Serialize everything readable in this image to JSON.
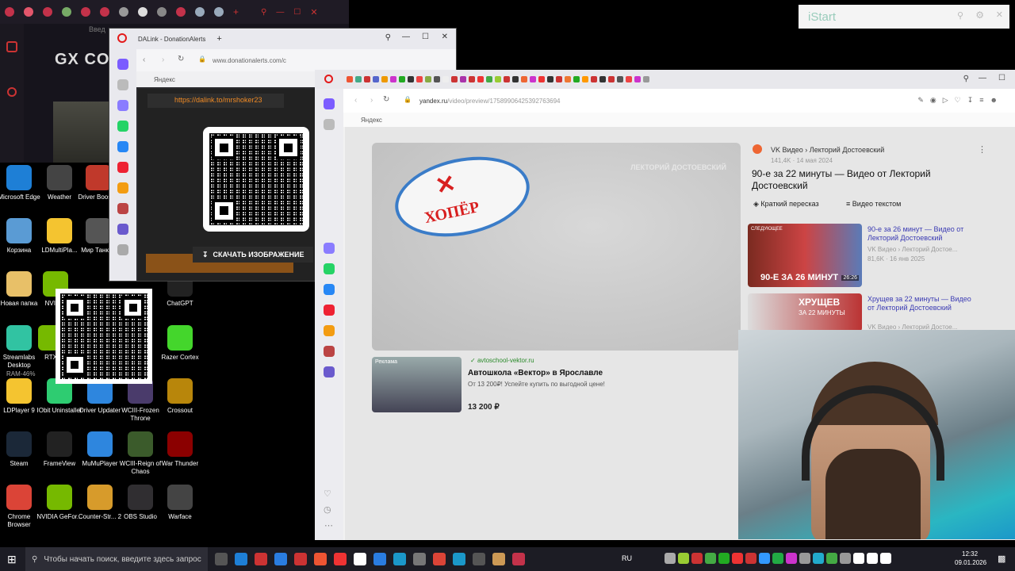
{
  "desktop": {
    "icons": [
      {
        "label": "Microsoft Edge",
        "color": "#1e7fd6"
      },
      {
        "label": "Weather",
        "color": "#444"
      },
      {
        "label": "Driver Booster",
        "color": "#c0392b"
      },
      {
        "label": "Корзина",
        "color": "#5a9bd4"
      },
      {
        "label": "LDMultiPla...",
        "color": "#f4c430"
      },
      {
        "label": "Мир Танков",
        "color": "#555"
      },
      {
        "label": "Новая папка",
        "color": "#e8c068"
      },
      {
        "label": "NVIDIA",
        "color": "#76b900"
      },
      {
        "label": "ChatGPT",
        "color": "#222"
      },
      {
        "label": "Streamlabs Desktop",
        "color": "#31c3a2"
      },
      {
        "label": "RTX",
        "color": "#76b900"
      },
      {
        "label": "Razer Cortex",
        "color": "#44d62c"
      },
      {
        "label": "LDPlayer 9",
        "color": "#f4c430"
      },
      {
        "label": "IObit Uninstaller",
        "color": "#2ecc71"
      },
      {
        "label": "Driver Updater",
        "color": "#2e86de"
      },
      {
        "label": "WCIII-Frozen Throne",
        "color": "#4a3b6b"
      },
      {
        "label": "Crossout",
        "color": "#b8860b"
      },
      {
        "label": "Steam",
        "color": "#1b2838"
      },
      {
        "label": "FrameView",
        "color": "#222"
      },
      {
        "label": "MuMuPlayer",
        "color": "#2e86de"
      },
      {
        "label": "WCIII-Reign of Chaos",
        "color": "#3b5b2b"
      },
      {
        "label": "War Thunder",
        "color": "#8b0000"
      },
      {
        "label": "Chrome Browser",
        "color": "#db4437"
      },
      {
        "label": "NVIDIA GeFor...",
        "color": "#76b900"
      },
      {
        "label": "Counter-Str... 2",
        "color": "#d79b2b"
      },
      {
        "label": "OBS Studio",
        "color": "#302e31"
      },
      {
        "label": "Warface",
        "color": "#444"
      }
    ],
    "ram_label": "RAM-46%"
  },
  "gx": {
    "logo": "GX CO",
    "address_placeholder": "Введ"
  },
  "dalink": {
    "tab_title": "DALink - DonationAlerts",
    "url": "www.donationalerts.com/c",
    "bookmark": "Яндекс",
    "link": "https://dalink.to/mrshoker23",
    "download_button": "СКАЧАТЬ ИЗОБРАЖЕНИЕ"
  },
  "yandex": {
    "url_host": "yandex.ru",
    "url_path": "/video/preview/17589906425392763694",
    "bookmark": "Яндекс",
    "channel": "VK Видео › Лекторий Достоевский",
    "views_date": "141,4K · 14 мая 2024",
    "title": "90-е за 22 минуты — Видео от Лекторий Достоевский",
    "chip_summary": "Краткий пересказ",
    "chip_text": "Видео текстом",
    "watermark": "ЛЕКТОРИЙ ДОСТОЕВСКИЙ",
    "logo_text": "ХОПЁР",
    "ad": {
      "domain": "avtoschool-vektor.ru",
      "badge": "Реклама",
      "title": "Автошкола «Вектор» в Ярославле",
      "desc": "От 13 200₽! Успейте купить по выгодной цене!",
      "price": "13 200 ₽"
    },
    "related": [
      {
        "title": "90-е за 26 минут — Видео от Лекторий Достоевский",
        "meta": "VK Видео › Лекторий Достое...",
        "stats": "81,6K · 16 янв 2025",
        "thumb_text": "90-Е ЗА 26 МИНУТ",
        "duration": "26:26",
        "next_label": "СЛЕДУЮЩЕЕ"
      },
      {
        "title": "Хрущев за 22 минуты — Видео от Лекторий Достоевский",
        "meta": "VK Видео › Лекторий Достое...",
        "thumb_text": "ХРУЩЕВ",
        "thumb_sub": "ЗА 22 МИНУТЫ"
      }
    ]
  },
  "istart": {
    "label": "iStart"
  },
  "taskbar": {
    "search_placeholder": "Чтобы начать поиск, введите здесь запрос",
    "lang": "RU",
    "time": "12:32",
    "date": "09.01.2026"
  }
}
